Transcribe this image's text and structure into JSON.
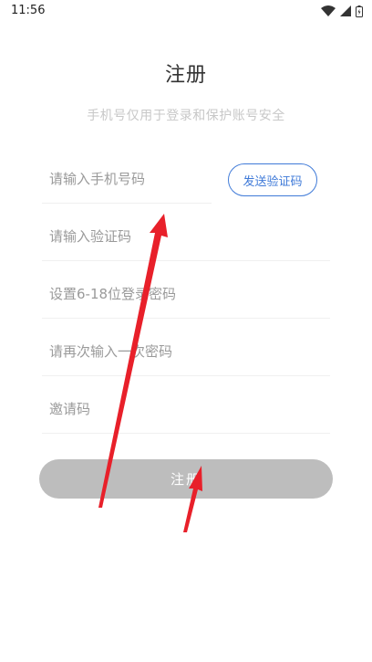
{
  "status_bar": {
    "time": "11:56",
    "icons": [
      "wifi-icon",
      "signal-icon",
      "battery-icon"
    ]
  },
  "header": {
    "title": "注册",
    "subtitle": "手机号仅用于登录和保护账号安全"
  },
  "form": {
    "phone_placeholder": "请输入手机号码",
    "send_code_label": "发送验证码",
    "code_placeholder": "请输入验证码",
    "password_placeholder": "设置6-18位登录密码",
    "confirm_placeholder": "请再次输入一次密码",
    "invite_placeholder": "邀请码",
    "submit_label": "注册"
  },
  "colors": {
    "accent": "#3f7ad8",
    "button_disabled": "#bdbdbd",
    "annotation_arrow": "#e8202a"
  }
}
